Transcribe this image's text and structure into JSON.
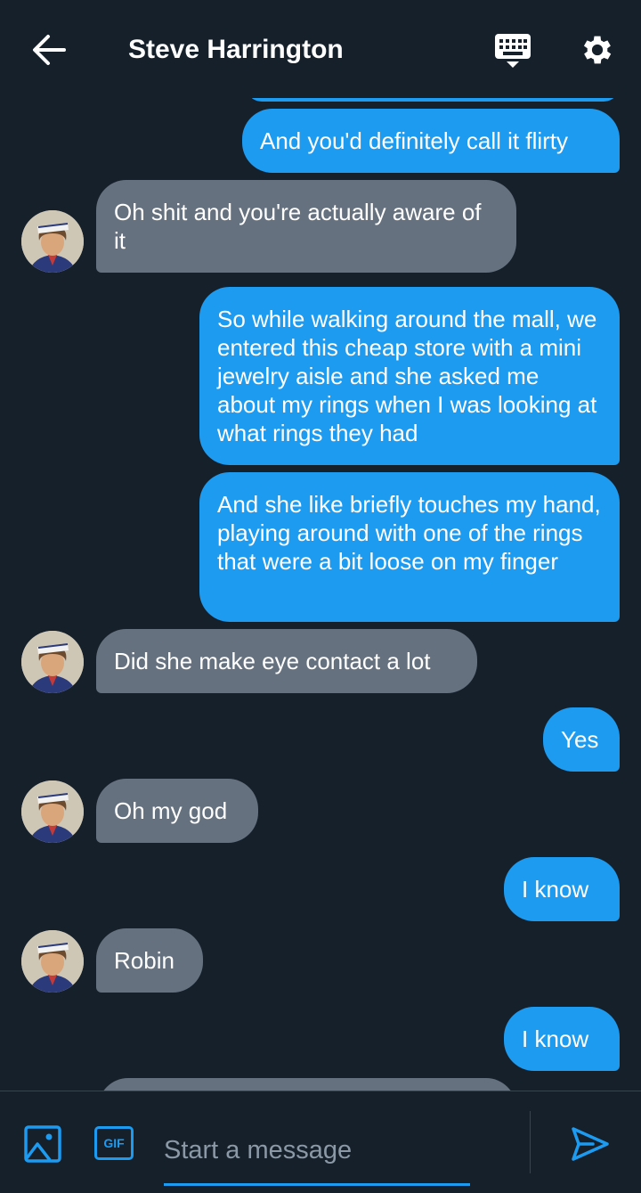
{
  "header": {
    "back_icon": "arrow-left-icon",
    "title": "Steve Harrington",
    "keyboard_icon": "keyboard-icon",
    "settings_icon": "gear-icon"
  },
  "messages": [
    {
      "side": "out",
      "text": "And you'd definitely call it flirty"
    },
    {
      "side": "in",
      "text": "Oh shit and you're actually aware of it"
    },
    {
      "side": "out",
      "text": "So while walking around the mall, we entered this cheap store with a mini jewelry aisle and she asked me about my rings when I was looking at what rings they had"
    },
    {
      "side": "out",
      "text": "And she like briefly touches my hand, playing around with one of the rings that were a bit loose on my finger"
    },
    {
      "side": "in",
      "text": "Did she make eye contact a lot"
    },
    {
      "side": "out",
      "text": "Yes"
    },
    {
      "side": "in",
      "text": "Oh my god"
    },
    {
      "side": "out",
      "text": "I know"
    },
    {
      "side": "in",
      "text": "Robin"
    },
    {
      "side": "out",
      "text": "I know"
    }
  ],
  "composer": {
    "image_icon": "image-icon",
    "gif_label": "GIF",
    "placeholder": "Start a message",
    "send_icon": "send-icon"
  },
  "colors": {
    "background": "#15202b",
    "outgoing_bubble": "#1d9bf0",
    "incoming_bubble": "#66717f",
    "accent": "#1d9bf0"
  }
}
